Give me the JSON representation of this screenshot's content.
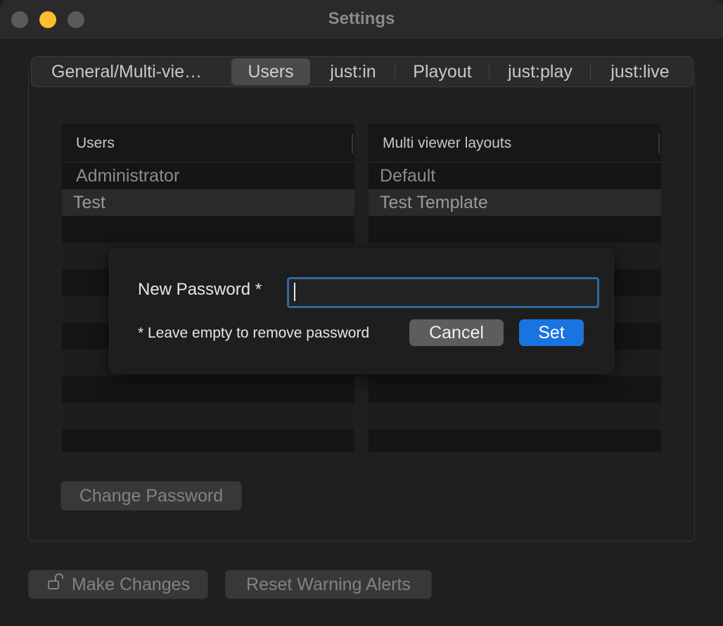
{
  "window": {
    "title": "Settings"
  },
  "tabs": [
    {
      "label": "General/Multi-vie…",
      "active": false
    },
    {
      "label": "Users",
      "active": true
    },
    {
      "label": "just:in",
      "active": false
    },
    {
      "label": "Playout",
      "active": false
    },
    {
      "label": "just:play",
      "active": false
    },
    {
      "label": "just:live",
      "active": false
    }
  ],
  "users_table": {
    "header": "Users",
    "rows": [
      "Administrator",
      "Test"
    ],
    "selected": "Test"
  },
  "layouts_table": {
    "header": "Multi viewer layouts",
    "rows": [
      "Default",
      "Test Template"
    ],
    "selected": "Test Template"
  },
  "buttons": {
    "change_password": "Change Password",
    "make_changes": "Make Changes",
    "reset_warning_alerts": "Reset Warning Alerts"
  },
  "dialog": {
    "label": "New Password *",
    "value": "",
    "hint": "* Leave empty to remove password",
    "cancel": "Cancel",
    "set": "Set"
  },
  "colors": {
    "accent": "#1a74e0",
    "focus_ring": "#2f6aa3",
    "minimize": "#febc2e"
  },
  "icons": {
    "make_changes": "unlocked-padlock-icon"
  }
}
